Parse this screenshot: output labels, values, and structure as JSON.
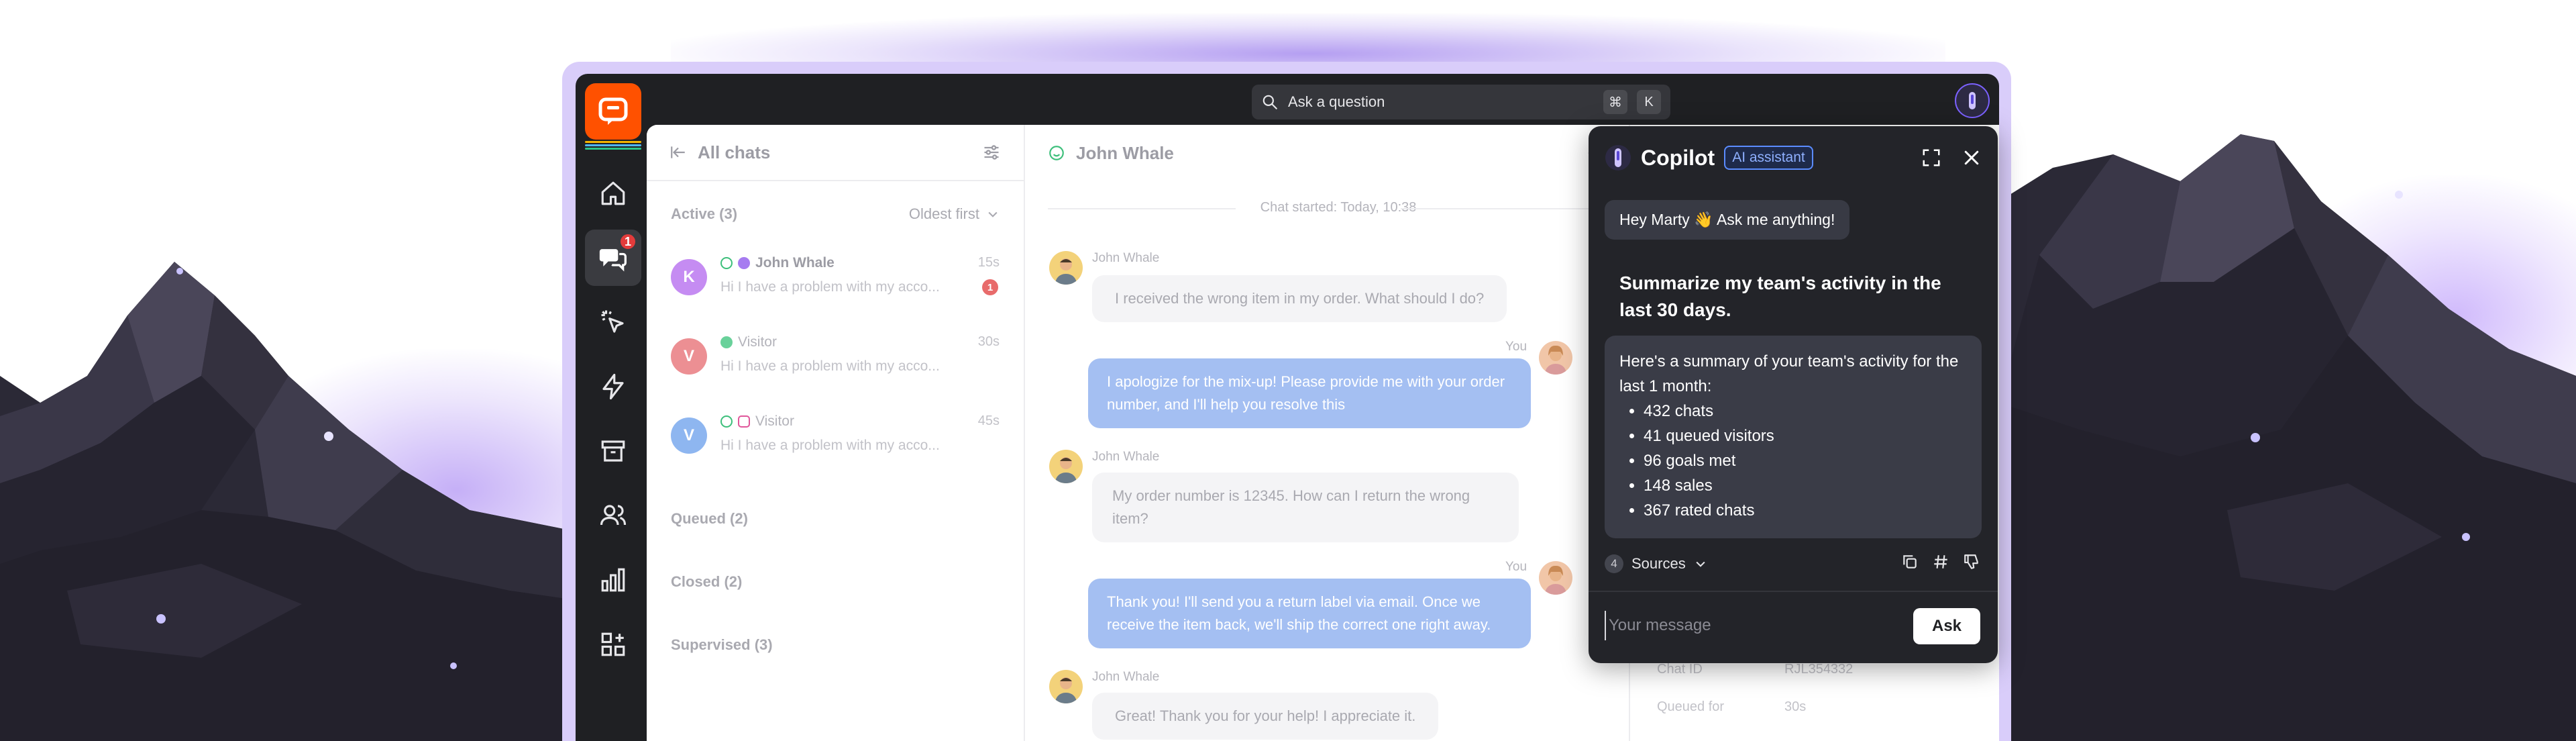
{
  "topbar": {
    "search_placeholder": "Ask a question",
    "shortcut_keys": [
      "⌘",
      "K"
    ]
  },
  "nav": {
    "items": [
      {
        "icon": "home-icon"
      },
      {
        "icon": "chats-icon",
        "badge": "1",
        "active": true
      },
      {
        "icon": "cursor-click-icon"
      },
      {
        "icon": "lightning-icon"
      },
      {
        "icon": "archive-icon"
      },
      {
        "icon": "users-icon"
      },
      {
        "icon": "bar-chart-icon"
      },
      {
        "icon": "apps-icon"
      }
    ]
  },
  "chatlist": {
    "title": "All chats",
    "active_label": "Active (3)",
    "sort_label": "Oldest first",
    "chats": [
      {
        "initial": "K",
        "name": "John Whale",
        "preview": "Hi I have a problem with my acco...",
        "time": "15s",
        "unread": "1",
        "color": "#c58cf2"
      },
      {
        "initial": "V",
        "name": "Visitor",
        "preview": "Hi I have a problem with my acco...",
        "time": "30s",
        "color": "#ec8f93"
      },
      {
        "initial": "V",
        "name": "Visitor",
        "preview": "Hi I have a problem with my acco...",
        "time": "45s",
        "color": "#8eb6f0"
      }
    ],
    "queued_label": "Queued (2)",
    "closed_label": "Closed (2)",
    "supervised_label": "Supervised (3)"
  },
  "conversation": {
    "name": "John Whale",
    "started": "Chat started: Today, 10:38",
    "messages": [
      {
        "author": "John Whale",
        "text": "I received the wrong item in my order. What should I do?"
      },
      {
        "author": "You",
        "text_line1": "I apologize for the mix-up! Please provide me with your order",
        "text_line2": "number, and I'll help you resolve this"
      },
      {
        "author": "John Whale",
        "text_line1": "My order number is 12345. How can I return the wrong",
        "text_line2": "item?"
      },
      {
        "author": "You",
        "text_line1": "Thank you! I'll send you a return label via email. Once we",
        "text_line2": "receive the item back, we'll ship the correct one right away."
      },
      {
        "author": "John Whale",
        "text": "Great! Thank you for your help! I appreciate it."
      }
    ]
  },
  "details": {
    "rows": [
      {
        "key": "Chat ID",
        "value": "RJL354332"
      },
      {
        "key": "Queued for",
        "value": "30s"
      }
    ]
  },
  "copilot": {
    "title": "Copilot",
    "badge": "AI assistant",
    "greeting": "Hey Marty 👋 Ask me anything!",
    "question": "Summarize my team's activity in the last 30 days.",
    "answer_intro": "Here's a summary of your team's activity for the last 1 month:",
    "answer_items": [
      "432 chats",
      "41 queued visitors",
      "96 goals met",
      "148 sales",
      "367 rated chats"
    ],
    "sources_count": "4",
    "sources_label": "Sources",
    "input_placeholder": "Your message",
    "ask_label": "Ask"
  },
  "colors": {
    "accent": "#7b61ff",
    "brand_orange": "#ff5100",
    "outgoing_bubble": "#a4bff2",
    "frame": "#1f2023"
  }
}
